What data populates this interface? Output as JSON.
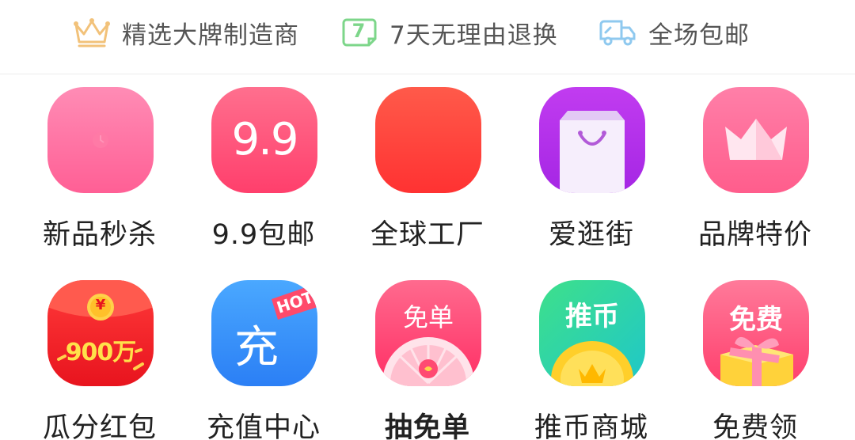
{
  "badges": [
    {
      "label": "精选大牌制造商",
      "icon": "crown-icon"
    },
    {
      "label": "7天无理由退换",
      "icon": "seven-day-return-icon",
      "icon_text": "7"
    },
    {
      "label": "全场包邮",
      "icon": "delivery-truck-icon"
    }
  ],
  "grid": {
    "row1": [
      {
        "label": "新品秒杀",
        "icon": "clock-icon"
      },
      {
        "label": "9.9包邮",
        "icon": "nine-nine-icon",
        "icon_text": "9.9"
      },
      {
        "label": "全球工厂",
        "icon": "factory-icon"
      },
      {
        "label": "爱逛街",
        "icon": "shopping-bag-icon"
      },
      {
        "label": "品牌特价",
        "icon": "crown-icon"
      }
    ],
    "row2": [
      {
        "label": "瓜分红包",
        "icon": "red-envelope-icon",
        "icon_text": "900万",
        "coin_text": "¥"
      },
      {
        "label": "充值中心",
        "icon": "recharge-icon",
        "icon_text": "充",
        "tag": "HOT"
      },
      {
        "label": "抽免单",
        "icon": "prize-wheel-icon",
        "icon_text": "免单"
      },
      {
        "label": "推币商城",
        "icon": "coin-pusher-icon",
        "icon_text": "推币"
      },
      {
        "label": "免费领",
        "icon": "gift-box-icon",
        "icon_text": "免费"
      }
    ]
  },
  "colors": {
    "badge_crown": "#f2c27a",
    "badge_return": "#7dd68a",
    "badge_truck": "#8fc9ef"
  }
}
